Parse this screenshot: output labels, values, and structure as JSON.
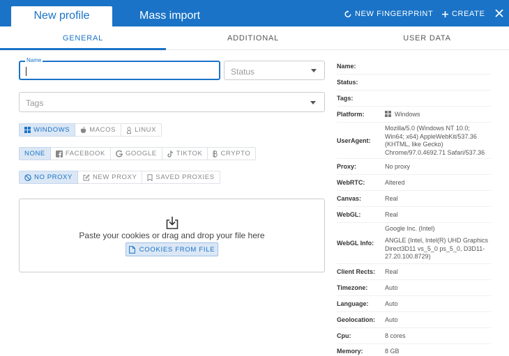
{
  "header": {
    "tab_active": "New profile",
    "tab_inactive": "Mass import",
    "new_fingerprint": "NEW FINGERPRINT",
    "create": "CREATE"
  },
  "subtabs": [
    "GENERAL",
    "ADDITIONAL",
    "USER DATA"
  ],
  "form": {
    "name_label": "Name",
    "name_value": "",
    "status_placeholder": "Status",
    "tags_placeholder": "Tags",
    "os_options": [
      "WINDOWS",
      "MACOS",
      "LINUX"
    ],
    "os_selected": "WINDOWS",
    "preset_options": [
      "NONE",
      "FACEBOOK",
      "GOOGLE",
      "TIKTOK",
      "CRYPTO"
    ],
    "preset_selected": "NONE",
    "proxy_options": [
      "NO PROXY",
      "NEW PROXY",
      "SAVED PROXIES"
    ],
    "proxy_selected": "NO PROXY",
    "cookies_text": "Paste your cookies or drag and drop your file here",
    "cookies_button": "COOKIES FROM FILE"
  },
  "summary": [
    {
      "key": "Name:",
      "value": ""
    },
    {
      "key": "Status:",
      "value": ""
    },
    {
      "key": "Tags:",
      "value": ""
    },
    {
      "key": "Platform:",
      "value": "Windows"
    },
    {
      "key": "UserAgent:",
      "value": "Mozilla/5.0 (Windows NT 10.0; Win64; x64) AppleWebKit/537.36 (KHTML, like Gecko) Chrome/97.0.4692.71 Safari/537.36"
    },
    {
      "key": "Proxy:",
      "value": "No proxy"
    },
    {
      "key": "WebRTC:",
      "value": "Altered"
    },
    {
      "key": "Canvas:",
      "value": "Real"
    },
    {
      "key": "WebGL:",
      "value": "Real"
    },
    {
      "key": "WebGL Info:",
      "value": "Google Inc. (Intel)",
      "value2": "ANGLE (Intel, Intel(R) UHD Graphics Direct3D11 vs_5_0 ps_5_0, D3D11-27.20.100.8729)"
    },
    {
      "key": "Client Rects:",
      "value": "Real"
    },
    {
      "key": "Timezone:",
      "value": "Auto"
    },
    {
      "key": "Language:",
      "value": "Auto"
    },
    {
      "key": "Geolocation:",
      "value": "Auto"
    },
    {
      "key": "Cpu:",
      "value": "8 cores"
    },
    {
      "key": "Memory:",
      "value": "8 GB"
    }
  ],
  "colors": {
    "accent": "#1a73c6",
    "selected_bg": "#dbe7f5"
  }
}
